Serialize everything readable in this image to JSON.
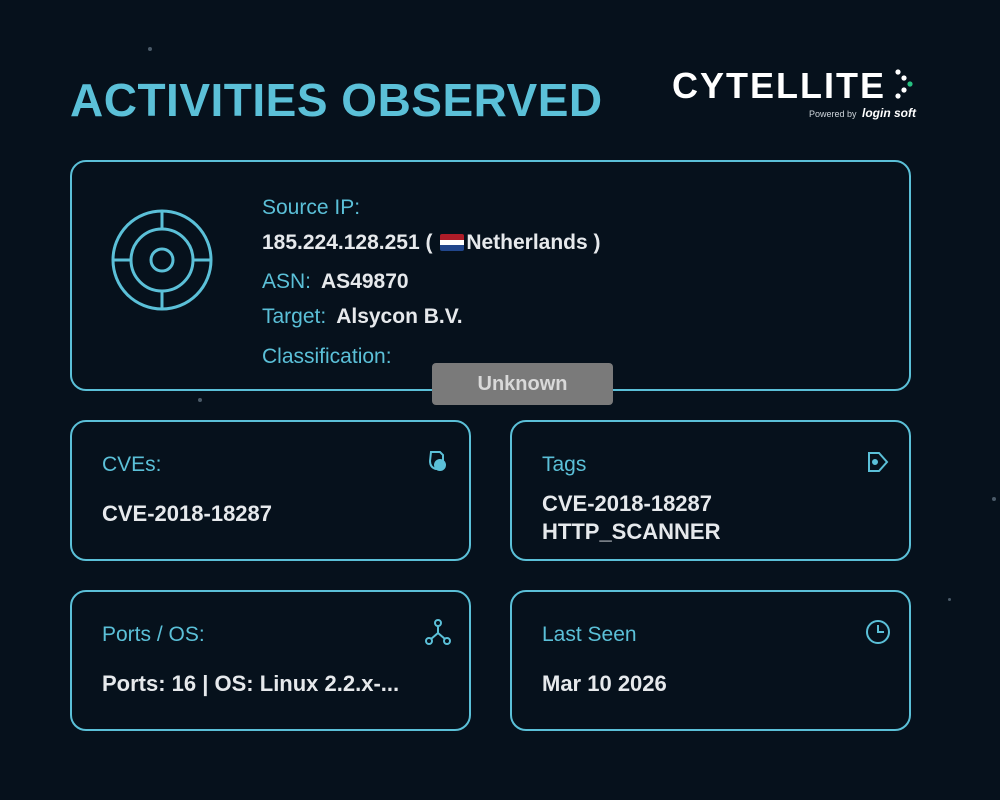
{
  "header": {
    "title": "ACTIVITIES OBSERVED",
    "brand": "CYTELLITE",
    "powered_by": "Powered by",
    "powered_logo": "login soft"
  },
  "source": {
    "source_ip_label": "Source IP:",
    "ip": "185.224.128.251",
    "country": "Netherlands",
    "asn_label": "ASN:",
    "asn": "AS49870",
    "target_label": "Target:",
    "target": "Alsycon B.V.",
    "classification_label": "Classification:",
    "classification": "Unknown"
  },
  "cves": {
    "label": "CVEs:",
    "value": "CVE-2018-18287",
    "icon": "shield-icon"
  },
  "tags": {
    "label": "Tags",
    "values": [
      "CVE-2018-18287",
      "HTTP_SCANNER"
    ],
    "icon": "tag-icon"
  },
  "ports_os": {
    "label": "Ports / OS:",
    "value": "Ports: 16 | OS: Linux 2.2.x-...",
    "icon": "network-icon"
  },
  "last_seen": {
    "label": "Last Seen",
    "value": "Mar 10 2026",
    "icon": "clock-icon"
  },
  "colors": {
    "accent": "#5bc0d8",
    "background": "#06111c",
    "badge_unknown": "#7a7a7a",
    "flag": [
      "#ae1c28",
      "#ffffff",
      "#21468b"
    ]
  }
}
